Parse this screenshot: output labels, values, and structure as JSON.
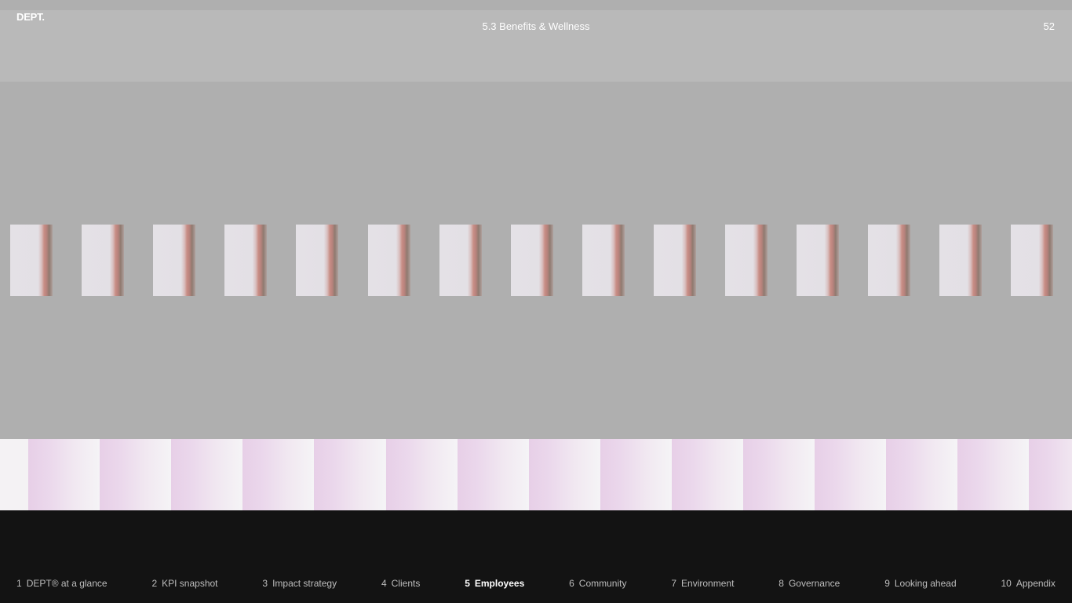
{
  "header": {
    "logo": "DEPT.",
    "section_title": "5.3 Benefits & Wellness",
    "page_number": "52"
  },
  "colors": {
    "background": "#afafaf",
    "header_background": "#b9b9b9",
    "footer_background": "#131313",
    "nav_text": "#bdbdbd",
    "nav_active_text": "#ffffff"
  },
  "nav": {
    "items": [
      {
        "num": "1",
        "label": "DEPT® at a glance"
      },
      {
        "num": "2",
        "label": "KPI snapshot"
      },
      {
        "num": "3",
        "label": "Impact strategy"
      },
      {
        "num": "4",
        "label": "Clients"
      },
      {
        "num": "5",
        "label": "Employees",
        "active": true
      },
      {
        "num": "6",
        "label": "Community"
      },
      {
        "num": "7",
        "label": "Environment"
      },
      {
        "num": "8",
        "label": "Governance"
      },
      {
        "num": "9",
        "label": "Looking ahead"
      },
      {
        "num": "10",
        "label": "Appendix"
      }
    ]
  }
}
